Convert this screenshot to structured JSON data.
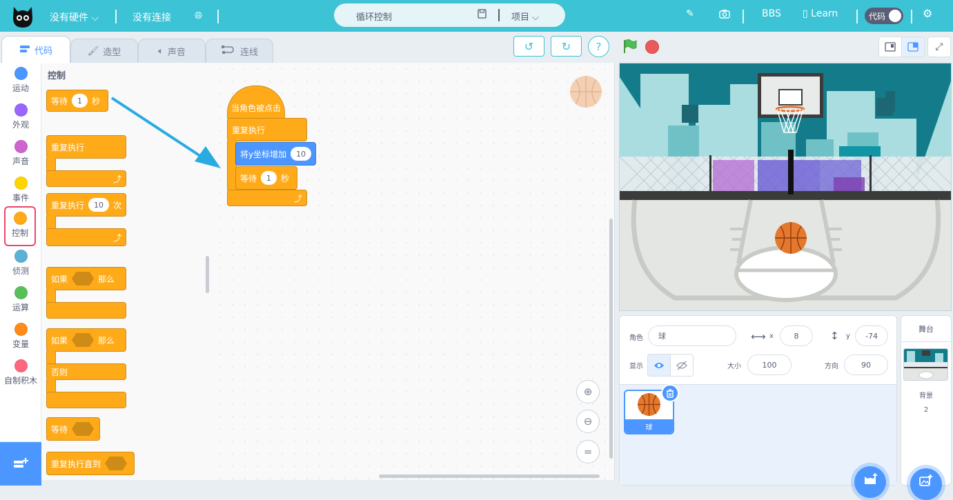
{
  "topbar": {
    "hardware_label": "没有硬件",
    "connection_label": "没有连接",
    "project_title": "循环控制",
    "project_menu": "项目",
    "bbs": "BBS",
    "learn": "Learn",
    "code_toggle": "代码"
  },
  "tabs": [
    {
      "label": "代码",
      "icon": "code-icon"
    },
    {
      "label": "造型",
      "icon": "brush-icon"
    },
    {
      "label": "声音",
      "icon": "speaker-icon"
    },
    {
      "label": "连线",
      "icon": "wire-icon"
    }
  ],
  "categories": [
    {
      "label": "运动",
      "color": "#4c97ff"
    },
    {
      "label": "外观",
      "color": "#9966ff"
    },
    {
      "label": "声音",
      "color": "#cf63cf"
    },
    {
      "label": "事件",
      "color": "#ffd500"
    },
    {
      "label": "控制",
      "color": "#ffab19"
    },
    {
      "label": "侦测",
      "color": "#5cb1d6"
    },
    {
      "label": "运算",
      "color": "#59c059"
    },
    {
      "label": "变量",
      "color": "#ff8c1a"
    },
    {
      "label": "自制积木",
      "color": "#ff6680"
    }
  ],
  "palette": {
    "heading": "控制",
    "wait_label": "等待",
    "wait_value": "1",
    "wait_unit": "秒",
    "forever_label": "重复执行",
    "repeat_label": "重复执行",
    "repeat_value": "10",
    "repeat_unit": "次",
    "if_label": "如果",
    "then_label": "那么",
    "if2_label": "如果",
    "then2_label": "那么",
    "else_label": "否则",
    "wait_until_label": "等待",
    "repeat_until_label": "重复执行直到"
  },
  "script": {
    "hat_label": "当角色被点击",
    "forever_label": "重复执行",
    "change_y_label": "将y坐标增加",
    "change_y_value": "10",
    "wait_label": "等待",
    "wait_value": "1",
    "wait_unit": "秒"
  },
  "zoom": {
    "reset": "="
  },
  "sprite_info": {
    "sprite_label": "角色",
    "sprite_name": "球",
    "x_label": "x",
    "x_value": "8",
    "y_label": "y",
    "y_value": "-74",
    "show_label": "显示",
    "size_label": "大小",
    "size_value": "100",
    "direction_label": "方向",
    "direction_value": "90"
  },
  "sprites": [
    {
      "name": "球"
    }
  ],
  "stage_panel": {
    "title": "舞台",
    "backdrop_label": "背景",
    "backdrop_count": "2"
  },
  "colors": {
    "accent": "#3cc3d6",
    "blue": "#4c97ff",
    "control": "#ffab19",
    "selected_border": "#e6476e"
  }
}
